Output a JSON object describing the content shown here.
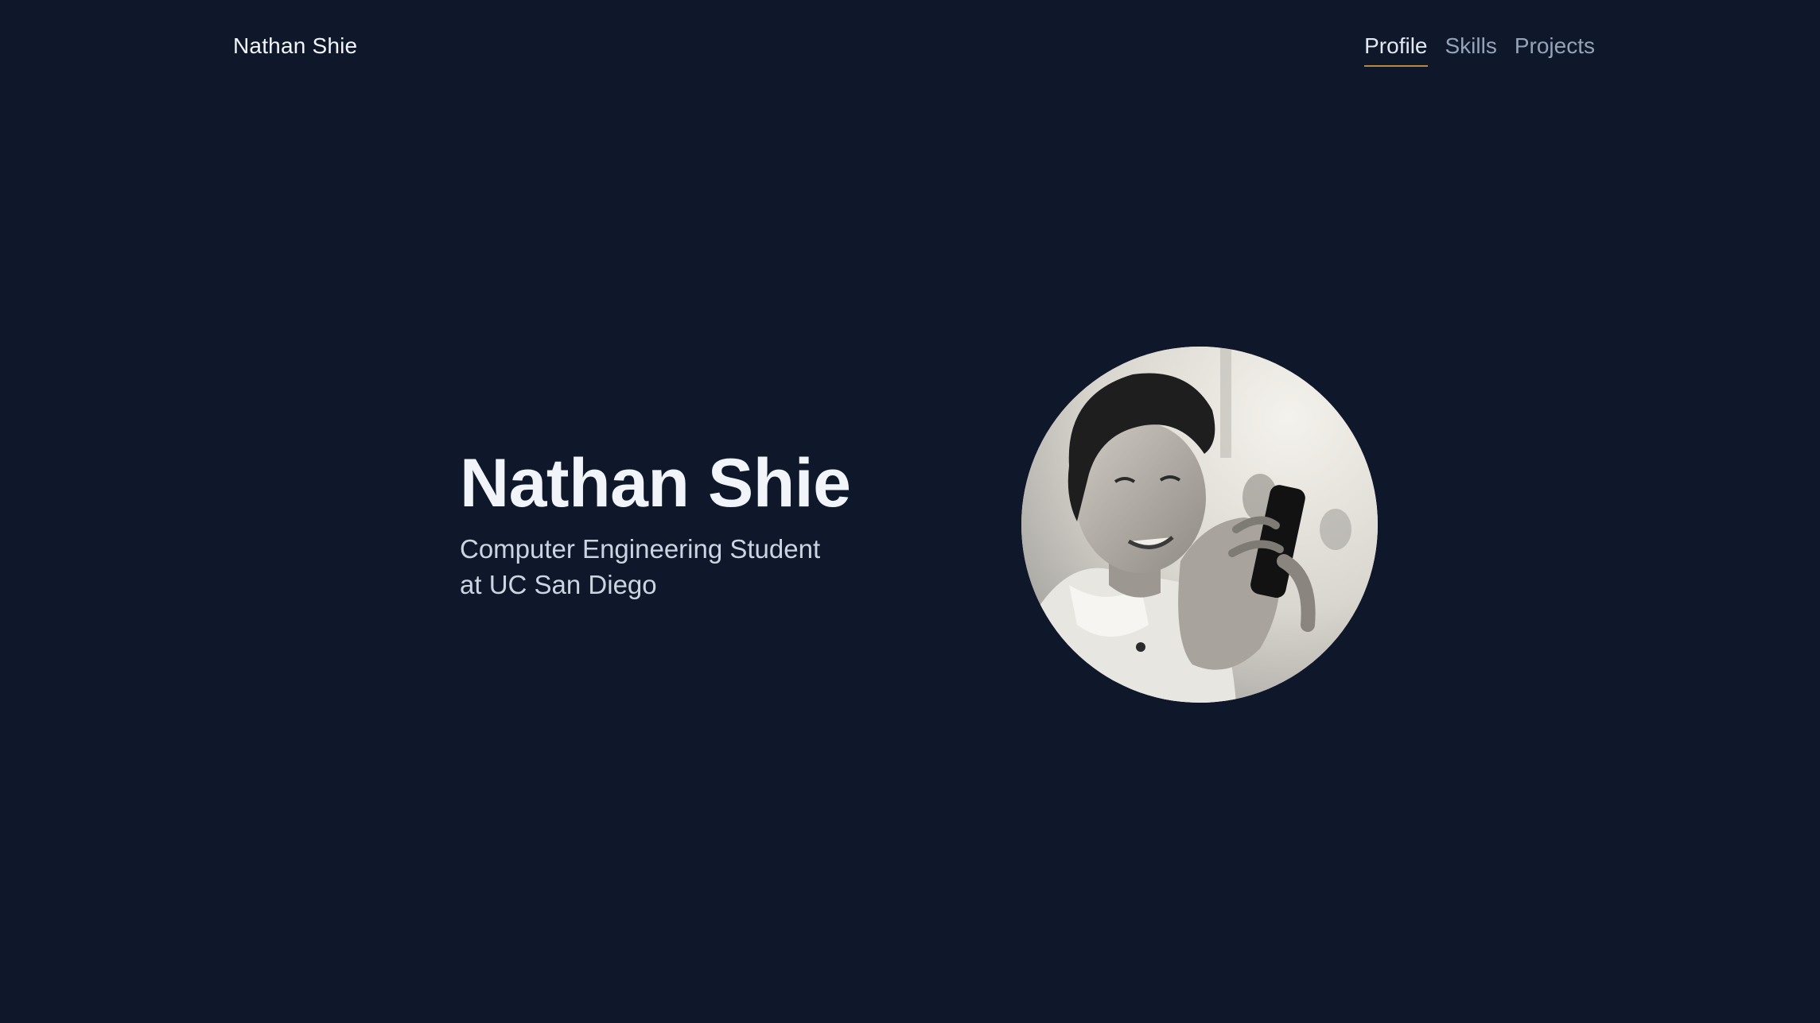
{
  "header": {
    "brand": "Nathan Shie",
    "nav": [
      {
        "label": "Profile",
        "active": true
      },
      {
        "label": "Skills",
        "active": false
      },
      {
        "label": "Projects",
        "active": false
      }
    ]
  },
  "hero": {
    "name": "Nathan Shie",
    "subtitle": "Computer Engineering Student at UC San Diego"
  },
  "colors": {
    "background": "#0f172a",
    "active_underline": "#b88a3b"
  }
}
